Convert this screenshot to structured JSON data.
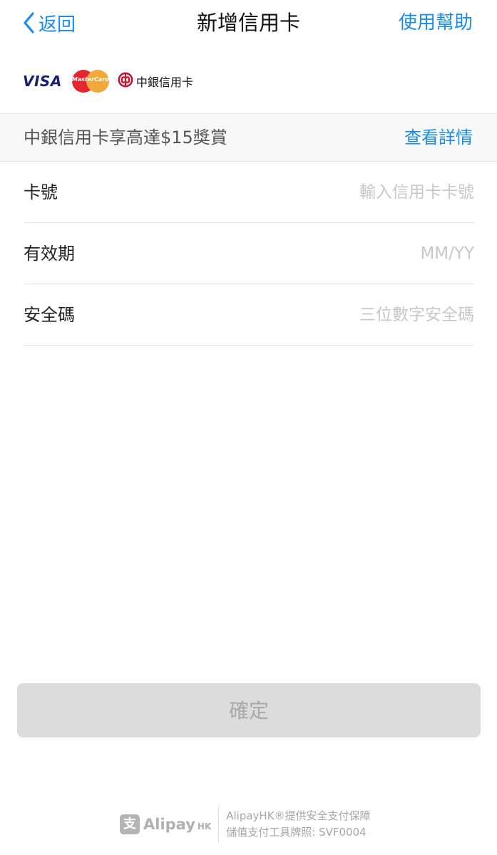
{
  "nav": {
    "back_label": "返回",
    "title": "新增信用卡",
    "help_label": "使用幫助"
  },
  "logos": {
    "visa": "VISA",
    "mastercard": "MasterCard",
    "boc": "中銀信用卡"
  },
  "promo": {
    "text": "中銀信用卡享高達$15獎賞",
    "link": "查看詳情"
  },
  "form": {
    "card_number": {
      "label": "卡號",
      "placeholder": "輸入信用卡卡號"
    },
    "expiry": {
      "label": "有效期",
      "placeholder": "MM/YY"
    },
    "cvv": {
      "label": "安全碼",
      "placeholder": "三位數字安全碼"
    }
  },
  "confirm_label": "確定",
  "footer": {
    "brand_mark": "支",
    "brand": "Alipay",
    "brand_suffix": "HK",
    "line1": "AlipayHK®提供安全支付保障",
    "line2": "儲值支付工具牌照: SVF0004"
  },
  "colors": {
    "accent": "#1a8ce8",
    "button_disabled_bg": "#dcdcdc",
    "button_disabled_text": "#a9a9a9"
  },
  "icons": {
    "back": "chevron-left-icon",
    "boc": "boc-logo-icon"
  }
}
